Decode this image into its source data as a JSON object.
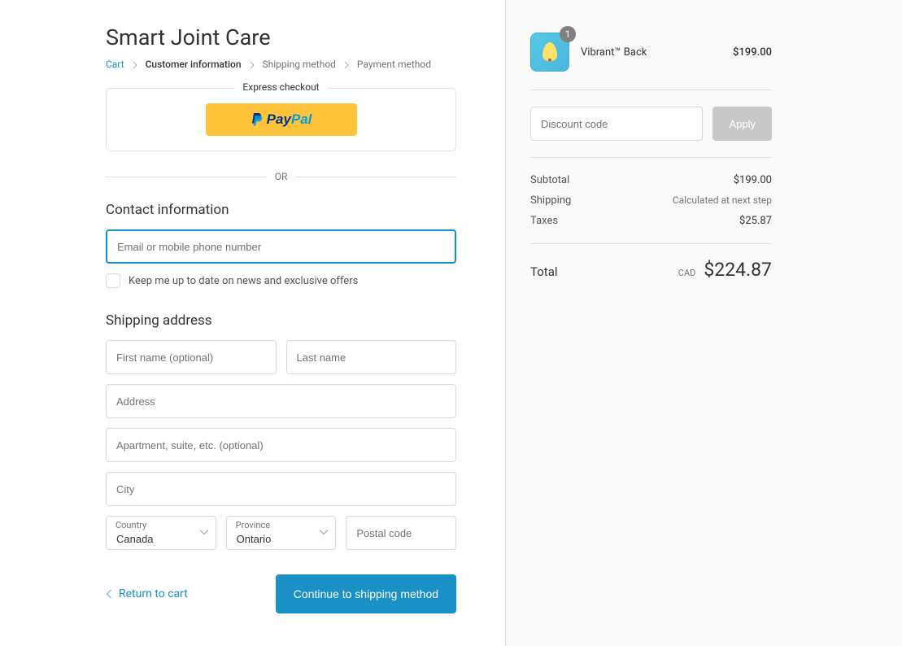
{
  "header": {
    "title": "Smart Joint Care",
    "breadcrumbs": {
      "cart": "Cart",
      "customer_info": "Customer information",
      "shipping": "Shipping method",
      "payment": "Payment method"
    }
  },
  "express": {
    "label": "Express checkout",
    "paypal_p1": "Pay",
    "paypal_p2": "Pal"
  },
  "separator_label": "OR",
  "contact": {
    "title": "Contact information",
    "email_placeholder": "Email or mobile phone number",
    "newsletter_label": "Keep me up to date on news and exclusive offers"
  },
  "shipping": {
    "title": "Shipping address",
    "first_name_placeholder": "First name (optional)",
    "last_name_placeholder": "Last name",
    "address_placeholder": "Address",
    "apt_placeholder": "Apartment, suite, etc. (optional)",
    "city_placeholder": "City",
    "country_label": "Country",
    "country_value": "Canada",
    "province_label": "Province",
    "province_value": "Ontario",
    "postal_placeholder": "Postal code"
  },
  "footer": {
    "return_label": "Return to cart",
    "continue_label": "Continue to shipping method"
  },
  "order": {
    "product_name": "Vibrant™ Back",
    "product_price": "$199.00",
    "quantity": "1",
    "discount_placeholder": "Discount code",
    "apply_label": "Apply",
    "subtotal_label": "Subtotal",
    "subtotal_value": "$199.00",
    "shipping_label": "Shipping",
    "shipping_value": "Calculated at next step",
    "taxes_label": "Taxes",
    "taxes_value": "$25.87",
    "total_label": "Total",
    "currency": "CAD",
    "total_value": "$224.87"
  }
}
